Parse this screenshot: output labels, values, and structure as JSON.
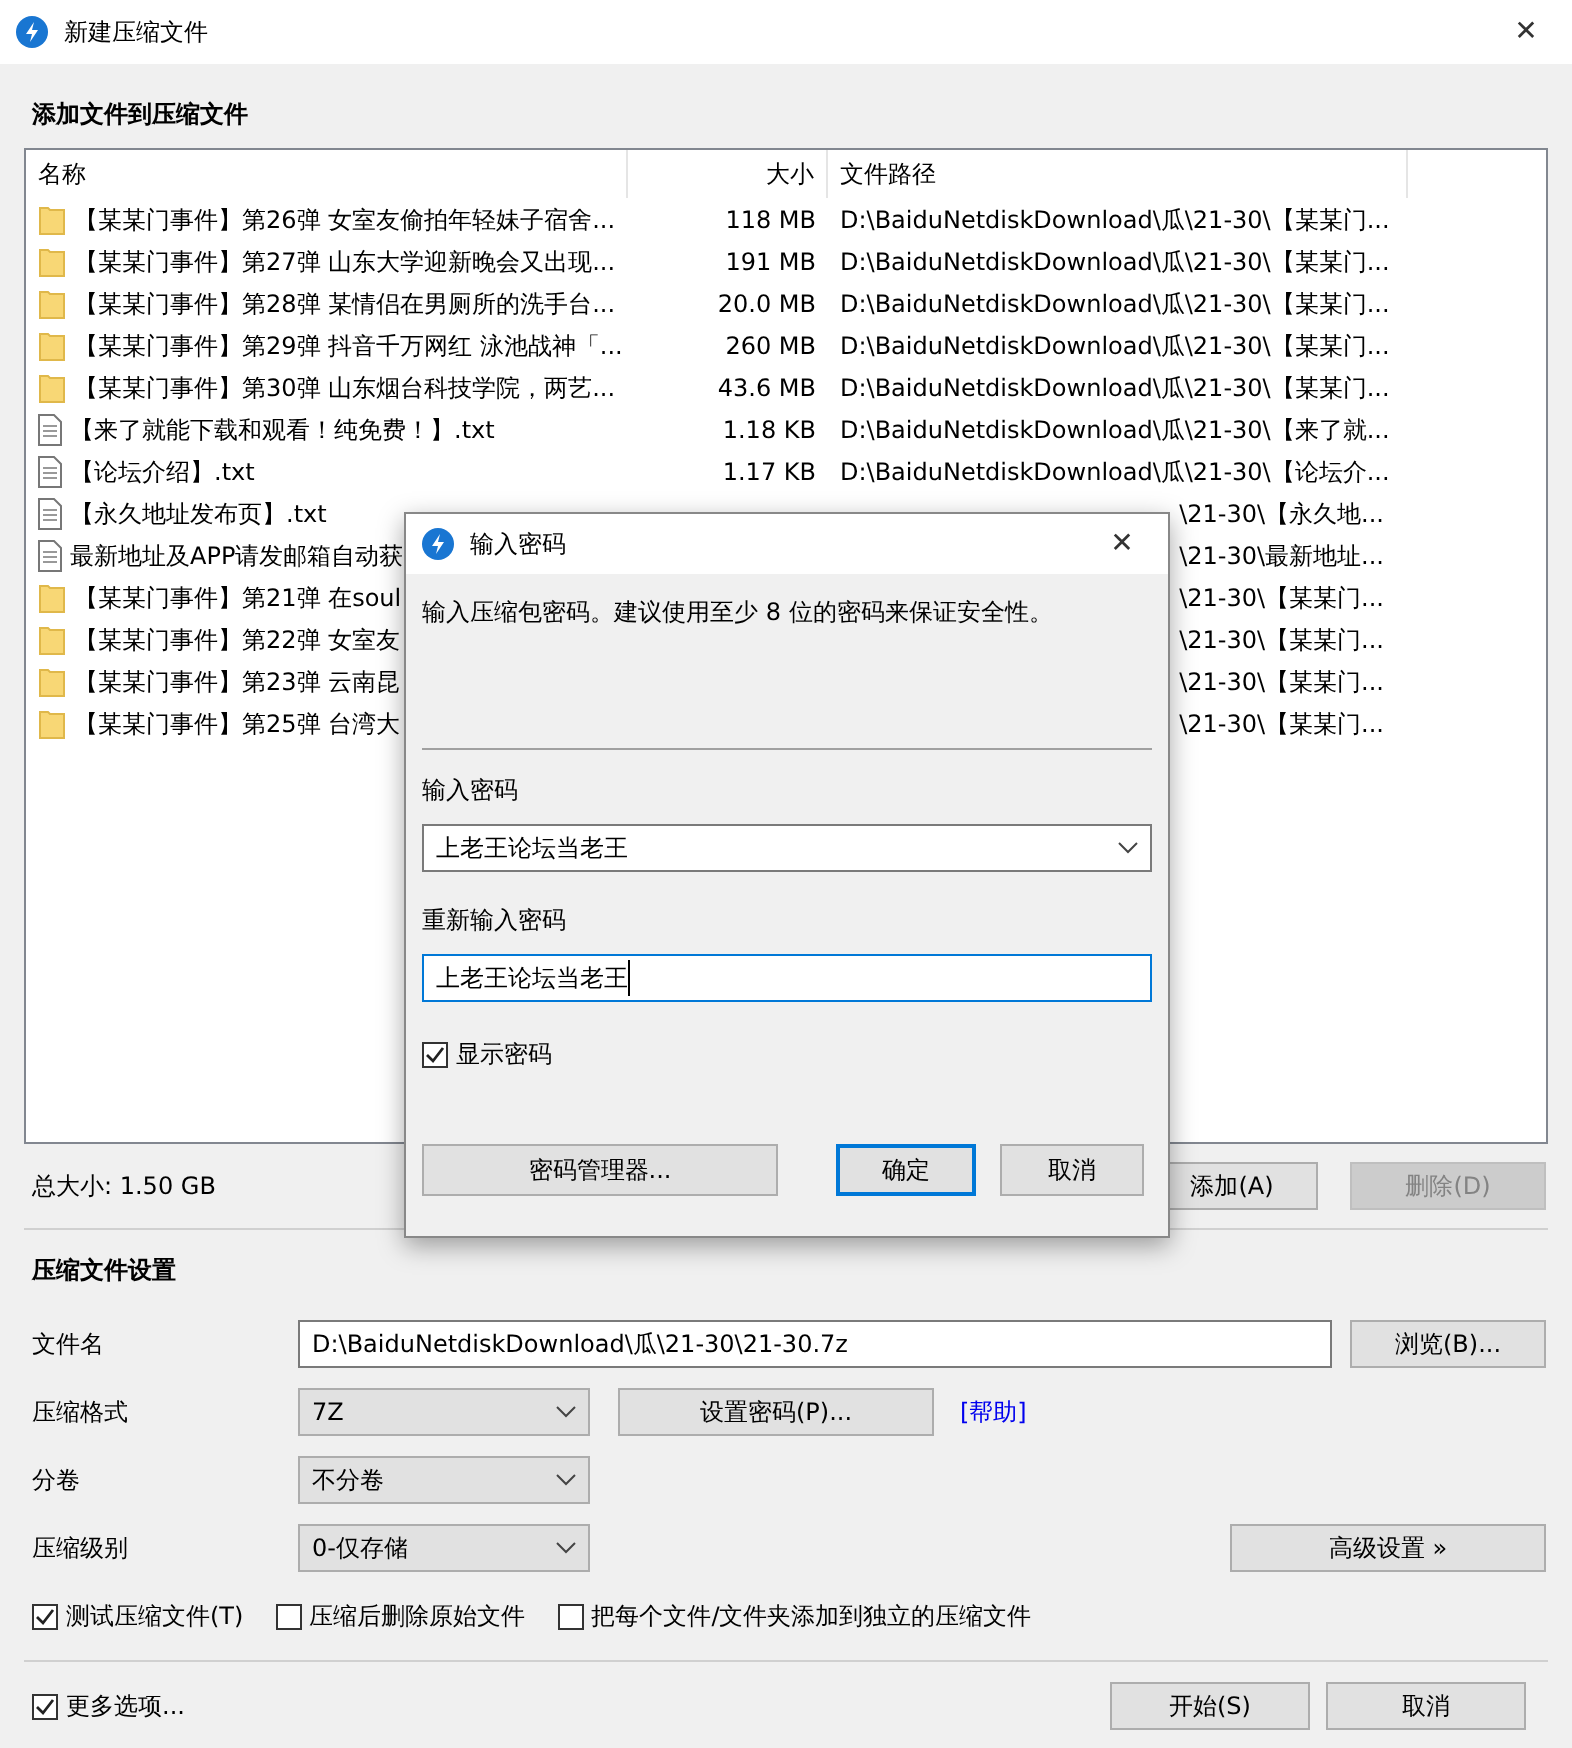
{
  "window": {
    "title": "新建压缩文件",
    "close": "✕"
  },
  "files_section": {
    "title": "添加文件到压缩文件",
    "columns": [
      "名称",
      "大小",
      "文件路径"
    ],
    "rows": [
      {
        "kind": "folder",
        "name": "【某某门事件】第26弹 女室友偷拍年轻妹子宿舍...",
        "size": "118 MB",
        "path": "D:\\BaiduNetdiskDownload\\瓜\\21-30\\【某某门..."
      },
      {
        "kind": "folder",
        "name": "【某某门事件】第27弹 山东大学迎新晚会又出现...",
        "size": "191 MB",
        "path": "D:\\BaiduNetdiskDownload\\瓜\\21-30\\【某某门..."
      },
      {
        "kind": "folder",
        "name": "【某某门事件】第28弹 某情侣在男厕所的洗手台...",
        "size": "20.0 MB",
        "path": "D:\\BaiduNetdiskDownload\\瓜\\21-30\\【某某门..."
      },
      {
        "kind": "folder",
        "name": "【某某门事件】第29弹 抖音千万网红 泳池战神「...",
        "size": "260 MB",
        "path": "D:\\BaiduNetdiskDownload\\瓜\\21-30\\【某某门..."
      },
      {
        "kind": "folder",
        "name": "【某某门事件】第30弹 山东烟台科技学院，两艺...",
        "size": "43.6 MB",
        "path": "D:\\BaiduNetdiskDownload\\瓜\\21-30\\【某某门..."
      },
      {
        "kind": "text",
        "name": "【来了就能下载和观看！纯免费！】.txt",
        "size": "1.18 KB",
        "path": "D:\\BaiduNetdiskDownload\\瓜\\21-30\\【来了就..."
      },
      {
        "kind": "text",
        "name": "【论坛介绍】.txt",
        "size": "1.17 KB",
        "path": "D:\\BaiduNetdiskDownload\\瓜\\21-30\\【论坛介..."
      },
      {
        "kind": "text",
        "name": "【永久地址发布页】.txt",
        "path": "\\21-30\\【永久地..."
      },
      {
        "kind": "text",
        "name": "最新地址及APP请发邮箱自动获",
        "path": "\\21-30\\最新地址..."
      },
      {
        "kind": "folder",
        "name": "【某某门事件】第21弹 在soul",
        "path": "\\21-30\\【某某门..."
      },
      {
        "kind": "folder",
        "name": "【某某门事件】第22弹 女室友",
        "path": "\\21-30\\【某某门..."
      },
      {
        "kind": "folder",
        "name": "【某某门事件】第23弹 云南昆",
        "path": "\\21-30\\【某某门..."
      },
      {
        "kind": "folder",
        "name": "【某某门事件】第25弹 台湾大",
        "path": "\\21-30\\【某某门..."
      }
    ],
    "total": "总大小: 1.50 GB",
    "buttons": [
      {
        "label": "添加(A)",
        "disabled": false
      },
      {
        "label": "删除(D)",
        "disabled": true
      }
    ]
  },
  "settings": {
    "title": "压缩文件设置",
    "file_name": {
      "label": "文件名",
      "value": "D:\\BaiduNetdiskDownload\\瓜\\21-30\\21-30.7z",
      "button": "浏览(B)..."
    },
    "format": {
      "label": "压缩格式",
      "value": "7Z",
      "button": "设置密码(P)...",
      "link": "[帮助]"
    },
    "volume": {
      "label": "分卷",
      "value": "不分卷"
    },
    "level": {
      "label": "压缩级别",
      "value": "0-仅存储",
      "button": "高级设置 »"
    },
    "options": [
      {
        "label": "测试压缩文件(T)",
        "checked": true
      },
      {
        "label": "压缩后删除原始文件",
        "checked": false
      },
      {
        "label": "把每个文件/文件夹添加到独立的压缩文件",
        "checked": false
      }
    ]
  },
  "footer": {
    "more_options": {
      "label": "更多选项...",
      "checked": true
    },
    "buttons": [
      {
        "label": "开始(S)"
      },
      {
        "label": "取消"
      }
    ]
  },
  "dialog": {
    "title": "输入密码",
    "close": "✕",
    "message": "输入压缩包密码。建议使用至少 8 位的密码来保证安全性。",
    "password_label": "输入密码",
    "password": "上老王论坛当老王",
    "confirm_label": "重新输入密码",
    "confirm": "上老王论坛当老王",
    "show_password": {
      "label": "显示密码",
      "checked": true
    },
    "buttons": [
      {
        "label": "密码管理器...",
        "default": false
      },
      {
        "label": "确定",
        "default": true
      },
      {
        "label": "取消",
        "default": false
      }
    ]
  }
}
